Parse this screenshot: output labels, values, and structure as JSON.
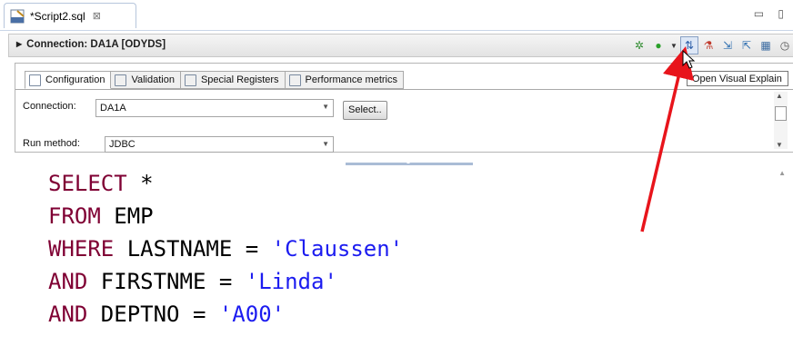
{
  "editor_tab": {
    "title": "*Script2.sql",
    "close_glyph": "⊠"
  },
  "window_controls": "▭ ▯",
  "connection_header": {
    "label": "Connection: DA1A [ODYDS]"
  },
  "toolbar": {
    "buttons": [
      {
        "name": "debug-icon",
        "glyph": "✲",
        "color": "#2e8b2e"
      },
      {
        "name": "run-icon",
        "glyph": "●",
        "color": "#2aa02a"
      },
      {
        "name": "run-dropdown-icon",
        "glyph": "▼",
        "color": "#333333"
      },
      {
        "name": "visual-explain-icon",
        "glyph": "⇅",
        "color": "#2f5fa8"
      },
      {
        "name": "tune-icon",
        "glyph": "⚗",
        "color": "#c0392b"
      },
      {
        "name": "export-icon",
        "glyph": "⇲",
        "color": "#2f6fb0"
      },
      {
        "name": "import-icon",
        "glyph": "⇱",
        "color": "#2f6fb0"
      },
      {
        "name": "report-icon",
        "glyph": "▦",
        "color": "#3a6aa0"
      },
      {
        "name": "history-icon",
        "glyph": "◷",
        "color": "#555555"
      }
    ]
  },
  "tooltip": {
    "text": "Open Visual Explain"
  },
  "config_tabs": [
    {
      "label": "Configuration",
      "icon": "document-icon"
    },
    {
      "label": "Validation",
      "icon": "validate-icon"
    },
    {
      "label": "Special Registers",
      "icon": "registers-icon"
    },
    {
      "label": "Performance metrics",
      "icon": "metrics-icon"
    }
  ],
  "config": {
    "connection_label": "Connection:",
    "connection_value": "DA1A",
    "select_button": "Select..",
    "run_method_label": "Run method:",
    "run_method_value": "JDBC"
  },
  "sql": {
    "line1": {
      "kw": "SELECT",
      "rest": " *"
    },
    "line2": {
      "kw": "FROM",
      "rest": " EMP"
    },
    "line3": {
      "kw": "WHERE",
      "rest": " LASTNAME = ",
      "str": "'Claussen'"
    },
    "line4": {
      "kw": "AND",
      "rest": " FIRSTNME = ",
      "str": "'Linda'"
    },
    "line5": {
      "kw": "AND",
      "rest": " DEPTNO = ",
      "str": "'A00'"
    }
  },
  "colors": {
    "annotation_arrow": "#e8141b",
    "keyword": "#7f0033",
    "string": "#1c1cf0"
  }
}
